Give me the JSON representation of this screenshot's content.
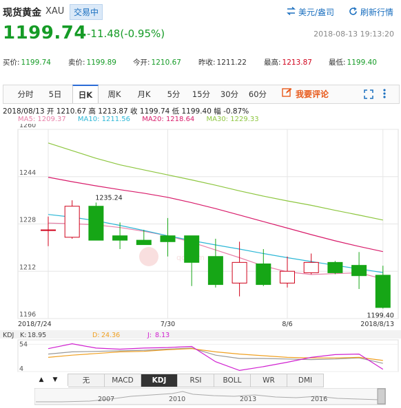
{
  "header": {
    "title": "现货黄金",
    "symbol": "XAU",
    "status": "交易中",
    "currency_link": "美元/盎司",
    "refresh_link": "刷新行情",
    "price": "1199.74",
    "change": "-11.48(-0.95%)",
    "timestamp": "2018-08-13 19:13:20"
  },
  "stats": [
    {
      "label": "买价:",
      "value": "1199.74",
      "color": "green"
    },
    {
      "label": "卖价:",
      "value": "1199.89",
      "color": "green"
    },
    {
      "label": "今开:",
      "value": "1210.67",
      "color": "green"
    },
    {
      "label": "昨收:",
      "value": "1211.22",
      "color": "black"
    },
    {
      "label": "最高:",
      "value": "1213.87",
      "color": "red"
    },
    {
      "label": "最低:",
      "value": "1199.40",
      "color": "green"
    }
  ],
  "tabs": [
    "分时",
    "5日",
    "日K",
    "周K",
    "月K",
    "5分",
    "15分",
    "30分",
    "60分"
  ],
  "active_tab": "日K",
  "comment_label": "我要评论",
  "info_line": "2018/08/13  开 1210.67  高 1213.87  收 1199.74  低 1199.40  幅 -0.87%",
  "ma_legend": [
    {
      "label": "MA5: 1209.37",
      "color": "#e87fa8"
    },
    {
      "label": "MA10: 1211.56",
      "color": "#2cb7d6"
    },
    {
      "label": "MA20: 1218.64",
      "color": "#d81b6a"
    },
    {
      "label": "MA30: 1229.33",
      "color": "#8dc63f"
    }
  ],
  "watermark": "qq.com",
  "colors": {
    "up": "#d0021b",
    "down": "#16a616",
    "accent": "#1a6fbf"
  },
  "chart_data": {
    "type": "candlestick",
    "y_ticks": [
      1196,
      1212,
      1228,
      1244,
      1260
    ],
    "ylim": [
      1196,
      1260
    ],
    "x_labels": [
      {
        "index": 0,
        "label": "2018/7/24"
      },
      {
        "index": 5,
        "label": "7/30"
      },
      {
        "index": 10,
        "label": "8/6"
      },
      {
        "index": 14,
        "label": "2018/8/13"
      }
    ],
    "annotations": [
      {
        "index": 2,
        "value": 1235.24,
        "label": "1235.24"
      },
      {
        "index": 14,
        "value": 1199.4,
        "label": "1199.40"
      }
    ],
    "candles": [
      {
        "open": 1226.0,
        "high": 1230.5,
        "low": 1220.5,
        "close": 1226.0
      },
      {
        "open": 1223.5,
        "high": 1236.0,
        "low": 1223.0,
        "close": 1234.0
      },
      {
        "open": 1234.0,
        "high": 1235.24,
        "low": 1222.5,
        "close": 1222.5
      },
      {
        "open": 1224.0,
        "high": 1228.5,
        "low": 1219.5,
        "close": 1222.5
      },
      {
        "open": 1222.5,
        "high": 1226.0,
        "low": 1221.0,
        "close": 1221.0
      },
      {
        "open": 1224.0,
        "high": 1230.0,
        "low": 1217.0,
        "close": 1222.0
      },
      {
        "open": 1224.0,
        "high": 1224.0,
        "low": 1207.0,
        "close": 1215.0
      },
      {
        "open": 1217.0,
        "high": 1223.0,
        "low": 1206.5,
        "close": 1207.5
      },
      {
        "open": 1208.0,
        "high": 1222.0,
        "low": 1203.5,
        "close": 1215.0
      },
      {
        "open": 1214.5,
        "high": 1219.5,
        "low": 1207.0,
        "close": 1207.5
      },
      {
        "open": 1208.0,
        "high": 1217.0,
        "low": 1206.5,
        "close": 1212.0
      },
      {
        "open": 1211.5,
        "high": 1218.0,
        "low": 1211.0,
        "close": 1215.0
      },
      {
        "open": 1215.0,
        "high": 1215.5,
        "low": 1211.0,
        "close": 1211.5
      },
      {
        "open": 1214.0,
        "high": 1218.5,
        "low": 1206.0,
        "close": 1210.5
      },
      {
        "open": 1210.67,
        "high": 1213.87,
        "low": 1199.4,
        "close": 1199.74
      }
    ],
    "series": [
      {
        "name": "MA5",
        "color": "#e87fa8",
        "values": [
          1228.3,
          1228.1,
          1227.7,
          1226.8,
          1225.5,
          1224.0,
          1221.8,
          1219.2,
          1216.6,
          1213.8,
          1211.8,
          1210.9,
          1211.2,
          1211.5,
          1209.4
        ]
      },
      {
        "name": "MA10",
        "color": "#2cb7d6",
        "values": [
          1231.2,
          1230.3,
          1229.1,
          1227.5,
          1225.8,
          1224.0,
          1222.4,
          1220.9,
          1219.5,
          1218.0,
          1216.6,
          1215.3,
          1214.0,
          1212.8,
          1211.56
        ]
      },
      {
        "name": "MA20",
        "color": "#d81b6a",
        "values": [
          1243.8,
          1242.3,
          1240.9,
          1239.6,
          1238.4,
          1237.0,
          1235.2,
          1233.2,
          1231.0,
          1228.8,
          1226.6,
          1224.4,
          1222.3,
          1220.4,
          1218.64
        ]
      },
      {
        "name": "MA30",
        "color": "#8dc63f",
        "values": [
          1255.4,
          1252.8,
          1250.2,
          1248.0,
          1246.3,
          1244.6,
          1242.9,
          1241.1,
          1239.2,
          1237.4,
          1235.8,
          1234.3,
          1232.6,
          1231.0,
          1229.33
        ]
      }
    ],
    "kdj": {
      "K": "18.95",
      "D": "24.36",
      "J": "8.13",
      "labels": {
        "kdj": "KDJ",
        "k": "K:",
        "d": "D:",
        "j": "J:"
      },
      "y_ticks": [
        4,
        54
      ],
      "ylim": [
        4,
        62
      ],
      "series": [
        {
          "name": "K",
          "color": "#999999",
          "values": [
            36,
            40,
            41,
            42,
            43,
            45,
            47,
            34,
            28,
            28,
            27,
            26,
            27,
            29,
            18.95
          ]
        },
        {
          "name": "D",
          "color": "#f0a020",
          "values": [
            30,
            34,
            37,
            40,
            41,
            44,
            46,
            40,
            36,
            33,
            30,
            29,
            29,
            30,
            24.36
          ]
        },
        {
          "name": "J",
          "color": "#d020d0",
          "values": [
            46,
            55,
            47,
            45,
            47,
            48,
            50,
            22,
            6,
            13,
            21,
            30,
            35,
            36,
            8.13
          ]
        }
      ]
    },
    "timeline_years": [
      "2007",
      "2010",
      "2013",
      "2016"
    ],
    "indicator_tabs": [
      "无",
      "MACD",
      "KDJ",
      "RSI",
      "BOLL",
      "WR",
      "DMI"
    ],
    "active_indicator": "KDJ"
  }
}
